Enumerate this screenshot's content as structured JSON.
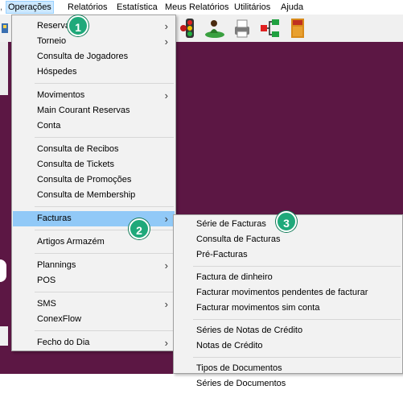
{
  "menubar": {
    "items": [
      "Operações",
      "Relatórios",
      "Estatística",
      "Meus Relatórios",
      "Utilitários",
      "Ajuda"
    ]
  },
  "operacoes_menu": {
    "groups": [
      [
        {
          "label": "Reservas",
          "submenu": true
        },
        {
          "label": "Torneio",
          "submenu": true
        },
        {
          "label": "Consulta de Jogadores",
          "submenu": false
        },
        {
          "label": "Hóspedes",
          "submenu": false
        }
      ],
      [
        {
          "label": "Movimentos",
          "submenu": true
        },
        {
          "label": "Main Courant Reservas",
          "submenu": false
        },
        {
          "label": "Conta",
          "submenu": false
        }
      ],
      [
        {
          "label": "Consulta de Recibos",
          "submenu": false
        },
        {
          "label": "Consulta de Tickets",
          "submenu": false
        },
        {
          "label": "Consulta de Promoções",
          "submenu": false
        },
        {
          "label": "Consulta de Membership",
          "submenu": false
        }
      ],
      [
        {
          "label": "Facturas",
          "submenu": true,
          "selected": true
        }
      ],
      [
        {
          "label": "Artigos Armazém",
          "submenu": false
        }
      ],
      [
        {
          "label": "Plannings",
          "submenu": true
        },
        {
          "label": "POS",
          "submenu": false
        }
      ],
      [
        {
          "label": "SMS",
          "submenu": true
        },
        {
          "label": "ConexFlow",
          "submenu": false
        }
      ],
      [
        {
          "label": "Fecho do Dia",
          "submenu": true
        }
      ]
    ]
  },
  "facturas_submenu": {
    "groups": [
      [
        "Série de Facturas",
        "Consulta de Facturas",
        "Pré-Facturas"
      ],
      [
        "Factura de dinheiro",
        "Facturar movimentos pendentes de facturar",
        "Facturar movimentos sim conta"
      ],
      [
        "Séries de Notas de Crédito",
        "Notas de Crédito"
      ],
      [
        "Tipos de Documentos",
        "Séries de Documentos"
      ]
    ]
  },
  "badges": [
    "1",
    "2",
    "3"
  ],
  "icons": [
    "app-icon",
    "traffic-light-icon",
    "golfer-icon",
    "printer-icon",
    "network-icon",
    "cabinet-icon"
  ],
  "colors": {
    "workspace": "#5c1744",
    "menu_background": "#f2f2f2",
    "selected_item": "#91c9f7",
    "badge": "#1fa97a"
  }
}
